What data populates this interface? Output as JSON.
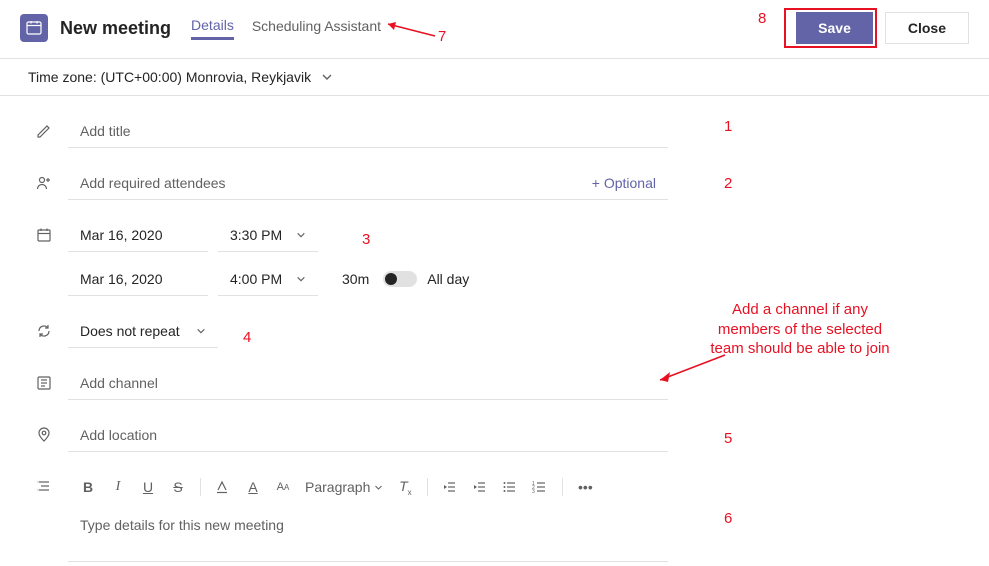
{
  "header": {
    "title": "New meeting",
    "tabs": {
      "details": "Details",
      "scheduling": "Scheduling Assistant"
    },
    "save": "Save",
    "close": "Close"
  },
  "timezone": {
    "label": "Time zone: (UTC+00:00) Monrovia, Reykjavik"
  },
  "fields": {
    "title_placeholder": "Add title",
    "attendees_placeholder": "Add required attendees",
    "optional_link": "+ Optional",
    "start_date": "Mar 16, 2020",
    "start_time": "3:30 PM",
    "end_date": "Mar 16, 2020",
    "end_time": "4:00 PM",
    "duration": "30m",
    "all_day": "All day",
    "repeat": "Does not repeat",
    "channel_placeholder": "Add channel",
    "location_placeholder": "Add location",
    "paragraph_label": "Paragraph",
    "details_placeholder": "Type details for this new meeting"
  },
  "annotations": {
    "n1": "1",
    "n2": "2",
    "n3": "3",
    "n4": "4",
    "n5": "5",
    "n6": "6",
    "n7": "7",
    "n8": "8",
    "channel_note": "Add a channel if any\nmembers of the selected\nteam should be able to join"
  }
}
